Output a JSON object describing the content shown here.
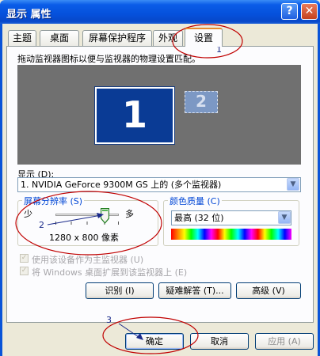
{
  "window": {
    "title": "显示 属性",
    "help_glyph": "?",
    "close_glyph": "✕"
  },
  "tabs": [
    {
      "label": "主题"
    },
    {
      "label": "桌面"
    },
    {
      "label": "屏幕保护程序"
    },
    {
      "label": "外观"
    },
    {
      "label": "设置",
      "active": true
    }
  ],
  "settings": {
    "instruction": "拖动监视器图标以便与监视器的物理设置匹配。",
    "monitor1_label": "1",
    "monitor2_label": "2",
    "display_label": "显示 (D):",
    "display_value": "1. NVIDIA GeForce 9300M GS 上的 (多个监视器)",
    "resolution_group": "屏幕分辨率 (S)",
    "resolution_less": "少",
    "resolution_more": "多",
    "resolution_value": "1280 x 800 像素",
    "resolution_slider_fraction": 0.78,
    "color_group": "颜色质量 (C)",
    "color_value": "最高 (32 位)",
    "primary_checkbox": "使用该设备作为主监视器 (U)",
    "extend_checkbox": "将 Windows 桌面扩展到该监视器上 (E)"
  },
  "panel_buttons": {
    "identify": "识别 (I)",
    "troubleshoot": "疑难解答 (T)...",
    "advanced": "高级 (V)"
  },
  "dialog_buttons": {
    "ok": "确定",
    "cancel": "取消",
    "apply": "应用 (A)"
  },
  "annotations": [
    "1",
    "2",
    "3"
  ],
  "colors": {
    "title_bar": "#0551dc",
    "active_tab_accent": "#e68b2c",
    "group_label": "#0046d5",
    "annotation_ink": "#c00000",
    "monitor1": "#0a3b95"
  },
  "icons": {
    "dropdown": "▼",
    "check": "✓"
  }
}
